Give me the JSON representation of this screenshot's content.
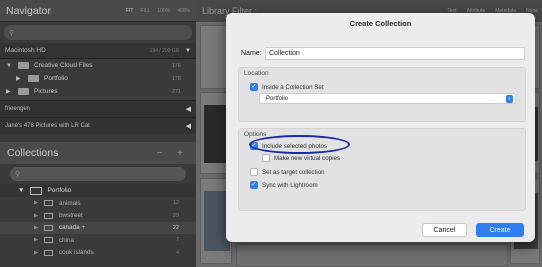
{
  "navigator": {
    "title": "Navigator",
    "zoom_options": [
      "FIT",
      "FILL",
      "100%",
      "400%"
    ],
    "search_placeholder": ""
  },
  "volume": {
    "name": "Macintosh HD",
    "size": "194 / 200 GB"
  },
  "folders": [
    {
      "label": "Creative Cloud Files",
      "count": "176",
      "indent": 0
    },
    {
      "label": "Portfolio",
      "count": "178",
      "indent": 1
    },
    {
      "label": "Pictures",
      "count": "271",
      "indent": 1
    }
  ],
  "sections": [
    {
      "label": "frieengen"
    },
    {
      "label": "Jane's 478 Pictures with LR Cat"
    }
  ],
  "collections": {
    "title": "Collections",
    "actions": "− +",
    "set_name": "Portfolio",
    "items": [
      {
        "label": "animals",
        "count": "12",
        "selected": false
      },
      {
        "label": "bwstreet",
        "count": "29",
        "selected": false
      },
      {
        "label": "canada +",
        "count": "22",
        "selected": true
      },
      {
        "label": "china",
        "count": "7",
        "selected": false
      },
      {
        "label": "cook islands",
        "count": "4",
        "selected": false
      }
    ]
  },
  "library_filter": {
    "title": "Library Filter :",
    "options": [
      "Text",
      "Attribute",
      "Metadata",
      "None"
    ]
  },
  "dialog": {
    "title": "Create Collection",
    "name_label": "Name:",
    "name_value": "Collection",
    "location_label": "Location",
    "inside_set_label": "Inside a Collection Set",
    "inside_set_checked": true,
    "set_value": "Portfolio",
    "options_label": "Options",
    "include_selected_label": "Include selected photos",
    "include_selected_checked": true,
    "make_virtual_label": "Make new virtual copies",
    "make_virtual_checked": false,
    "target_label": "Set as target collection",
    "target_checked": false,
    "sync_label": "Sync with Lightroom",
    "sync_checked": true,
    "cancel_label": "Cancel",
    "create_label": "Create"
  },
  "colors": {
    "accent": "#2f7ef6",
    "annotation_oval": "#1c2aa5"
  }
}
